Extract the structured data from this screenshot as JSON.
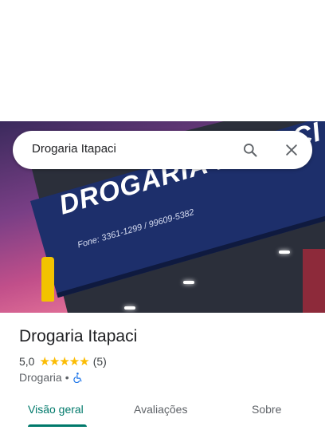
{
  "search": {
    "query": "Drogaria Itapaci"
  },
  "place": {
    "name": "Drogaria Itapaci",
    "rating": "5,0",
    "stars": "★★★★★",
    "review_count": "(5)",
    "category": "Drogaria",
    "separator": "•"
  },
  "photo": {
    "sign_text": "DROGARIA ITAPACI",
    "sign_phone": "Fone: 3361-1299 / 99609-5382"
  },
  "tabs": [
    {
      "label": "Visão geral",
      "active": true
    },
    {
      "label": "Avaliações",
      "active": false
    },
    {
      "label": "Sobre",
      "active": false
    }
  ],
  "colors": {
    "accent": "#00796b",
    "star": "#fbbc04",
    "access": "#1a73e8"
  }
}
